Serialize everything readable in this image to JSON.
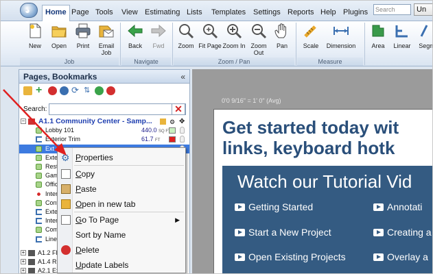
{
  "ribbon_tabs": [
    "Home",
    "Page",
    "Tools",
    "View",
    "Estimating",
    "Lists",
    "Templates",
    "Settings",
    "Reports",
    "Help",
    "Plugins"
  ],
  "search": {
    "placeholder": "Search"
  },
  "un_button": "Un",
  "ribbon": {
    "job": {
      "label": "Job",
      "buttons": [
        "New",
        "Open",
        "Print",
        "Email Job"
      ]
    },
    "navigate": {
      "label": "Navigate",
      "buttons": [
        "Back",
        "Fwd"
      ]
    },
    "zoom_pan": {
      "label": "Zoom / Pan",
      "buttons": [
        "Zoom",
        "Fit Page",
        "Zoom In",
        "Zoom Out",
        "Pan"
      ]
    },
    "measure": {
      "label": "Measure",
      "buttons": [
        "Scale",
        "Dimension"
      ]
    },
    "takeoff": {
      "buttons": [
        "Area",
        "Linear",
        "Segm"
      ]
    }
  },
  "left_panel": {
    "title": "Pages, Bookmarks",
    "collapse": "«",
    "search_label": "Search:",
    "search_clear": "✕",
    "tree": {
      "page_title": "A1.1 Community Center - Samp...",
      "items": [
        {
          "label": "Lobby 101",
          "value": "440.0",
          "unit": "SQ FT",
          "color": "#c8f0c0",
          "type": "area"
        },
        {
          "label": "Exterior Trim",
          "value": "61.7",
          "unit": "FT",
          "color": "#e02020",
          "type": "linear"
        },
        {
          "label": "Ext",
          "value": "",
          "unit": "",
          "color": "",
          "type": "area"
        },
        {
          "label": "Exte",
          "value": "",
          "unit": "",
          "color": "",
          "type": "area"
        },
        {
          "label": "Rest",
          "value": "",
          "unit": "",
          "color": "",
          "type": "area"
        },
        {
          "label": "Gam",
          "value": "",
          "unit": "",
          "color": "",
          "type": "area"
        },
        {
          "label": "Offic",
          "value": "",
          "unit": "",
          "color": "",
          "type": "area"
        },
        {
          "label": "Interi",
          "value": "",
          "unit": "",
          "color": "",
          "type": "count"
        },
        {
          "label": "Confi",
          "value": "",
          "unit": "",
          "color": "",
          "type": "area"
        },
        {
          "label": "Exte",
          "value": "",
          "unit": "",
          "color": "",
          "type": "linear"
        },
        {
          "label": "Inter",
          "value": "",
          "unit": "",
          "color": "",
          "type": "linear"
        },
        {
          "label": "Com",
          "value": "",
          "unit": "",
          "color": "",
          "type": "area"
        },
        {
          "label": "Linea",
          "value": "",
          "unit": "",
          "color": "",
          "type": "linear"
        }
      ],
      "other_pages": [
        "A1.2 Flo",
        "A1.4 Ro",
        "A2.1 Ex"
      ]
    }
  },
  "canvas": {
    "scale_readout": "0'0 9/16\" = 1' 0\" (Avg)",
    "headline_1": "Get started today wit",
    "headline_2": "links, keyboard hotk",
    "tutorial_title": "Watch our Tutorial Vid",
    "links": [
      "Getting Started",
      "Annotati",
      "Start a New Project",
      "Creating a",
      "Open Existing Projects",
      "Overlay a"
    ]
  },
  "context_menu": {
    "items": [
      {
        "label": "Properties",
        "accel": "P",
        "icon": "properties-gear-icon"
      },
      {
        "label": "Copy",
        "accel": "C",
        "icon": "copy-icon"
      },
      {
        "label": "Paste",
        "accel": "P",
        "icon": "paste-icon"
      },
      {
        "label": "Open in new tab",
        "accel": "O",
        "icon": "open-new-tab-icon"
      },
      {
        "label": "Go To Page",
        "accel": "G",
        "icon": "go-to-page-icon"
      },
      {
        "label": "Sort by Name",
        "accel": "",
        "icon": ""
      },
      {
        "label": "Delete",
        "accel": "D",
        "icon": "delete-icon"
      },
      {
        "label": "Update Labels",
        "accel": "U",
        "icon": ""
      }
    ],
    "submenu_arrow": "▶"
  },
  "colors": {
    "accent": "#15387a",
    "tutorial_bg": "#345b82",
    "headline": "#2a4f7a",
    "arrow": "#e02020"
  }
}
